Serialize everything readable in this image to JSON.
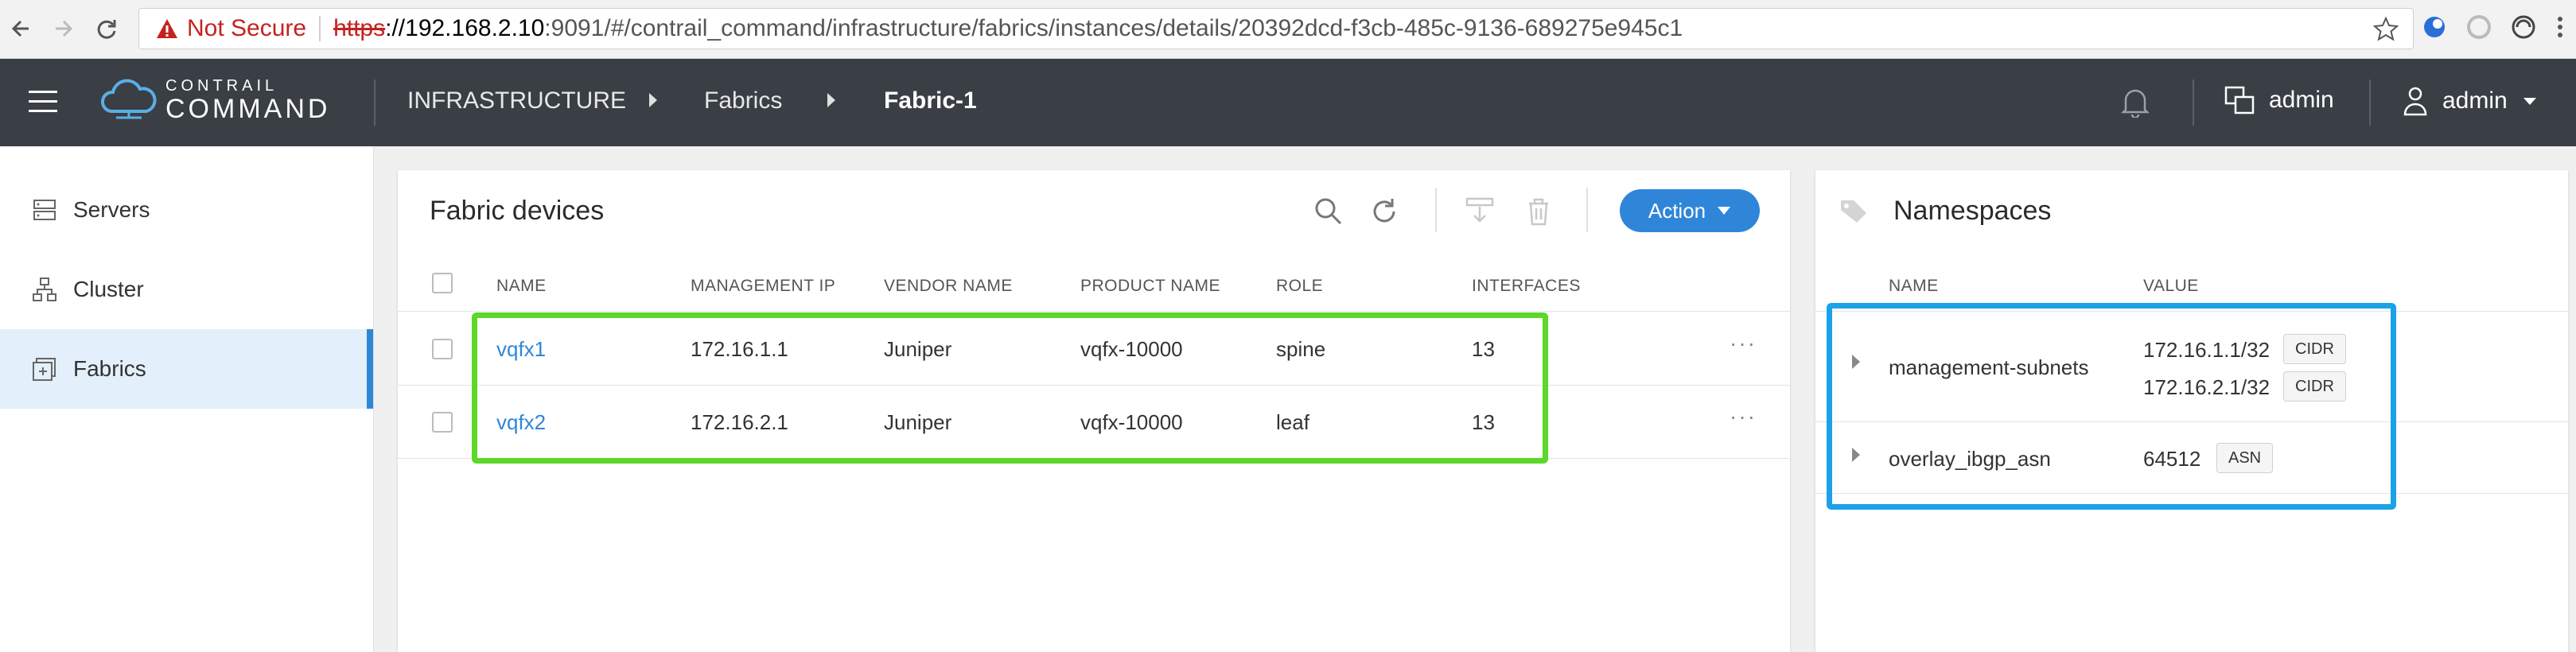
{
  "browser": {
    "not_secure": "Not Secure",
    "url_scheme": "https",
    "url_host": "://192.168.2.10",
    "url_rest": ":9091/#/contrail_command/infrastructure/fabrics/instances/details/20392dcd-f3cb-485c-9136-689275e945c1"
  },
  "header": {
    "logo_top": "CONTRAIL",
    "logo_bottom": "COMMAND",
    "breadcrumbs": [
      "INFRASTRUCTURE",
      "Fabrics",
      "Fabric-1"
    ],
    "tenant": "admin",
    "user": "admin"
  },
  "sidebar": {
    "items": [
      {
        "label": "Servers",
        "icon": "server-icon"
      },
      {
        "label": "Cluster",
        "icon": "cluster-icon"
      },
      {
        "label": "Fabrics",
        "icon": "fabric-icon",
        "active": true
      }
    ]
  },
  "devices": {
    "title": "Fabric devices",
    "action_label": "Action",
    "columns": [
      "NAME",
      "MANAGEMENT IP",
      "VENDOR NAME",
      "PRODUCT NAME",
      "ROLE",
      "INTERFACES"
    ],
    "rows": [
      {
        "name": "vqfx1",
        "ip": "172.16.1.1",
        "vendor": "Juniper",
        "product": "vqfx-10000",
        "role": "spine",
        "interfaces": "13"
      },
      {
        "name": "vqfx2",
        "ip": "172.16.2.1",
        "vendor": "Juniper",
        "product": "vqfx-10000",
        "role": "leaf",
        "interfaces": "13"
      }
    ],
    "more": "···"
  },
  "namespaces": {
    "title": "Namespaces",
    "columns": [
      "NAME",
      "VALUE"
    ],
    "rows": [
      {
        "name": "management-subnets",
        "values": [
          {
            "value": "172.16.1.1/32",
            "tag": "CIDR"
          },
          {
            "value": "172.16.2.1/32",
            "tag": "CIDR"
          }
        ]
      },
      {
        "name": "overlay_ibgp_asn",
        "values": [
          {
            "value": "64512",
            "tag": "ASN"
          }
        ]
      }
    ]
  },
  "colors": {
    "accent": "#2f86d9",
    "header_bg": "#393f44",
    "highlight_green": "#5bd829",
    "highlight_blue": "#1aa3e8"
  }
}
